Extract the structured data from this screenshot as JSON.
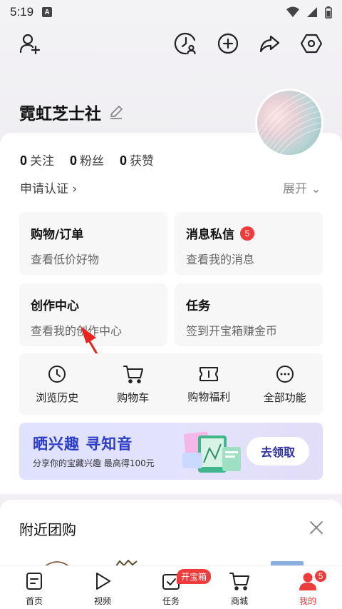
{
  "status_bar": {
    "time": "5:19",
    "a_label": "A"
  },
  "profile": {
    "name": "霓虹芝士社"
  },
  "stats": [
    {
      "num": "0",
      "label": "关注"
    },
    {
      "num": "0",
      "label": "粉丝"
    },
    {
      "num": "0",
      "label": "获赞"
    }
  ],
  "verify_label": "申请认证 ›",
  "expand_label": "展开 ⌄",
  "tiles": {
    "shopping": {
      "title": "购物/订单",
      "sub": "查看低价好物"
    },
    "messages": {
      "title": "消息私信",
      "badge": "5",
      "sub": "查看我的消息"
    },
    "creator": {
      "title": "创作中心",
      "sub": "查看我的创作中心"
    },
    "tasks": {
      "title": "任务",
      "sub": "签到开宝箱赚金币"
    }
  },
  "quick_items": [
    {
      "label": "浏览历史",
      "icon": "clock-icon"
    },
    {
      "label": "购物车",
      "icon": "cart-icon"
    },
    {
      "label": "购物福利",
      "icon": "ticket-icon"
    },
    {
      "label": "全部功能",
      "icon": "more-icon"
    }
  ],
  "banner": {
    "title": "晒兴趣 寻知音",
    "subtitle": "分享你的宝藏兴趣 最高得100元",
    "button": "去领取"
  },
  "nearby": {
    "title": "附近团购"
  },
  "bottom_nav": {
    "items": [
      {
        "label": "首页",
        "icon": "home-icon"
      },
      {
        "label": "视频",
        "icon": "play-icon"
      },
      {
        "label": "任务",
        "icon": "task-icon"
      },
      {
        "label": "商城",
        "icon": "cart-icon"
      },
      {
        "label": "我的",
        "icon": "user-icon"
      }
    ],
    "task_badge": "开宝箱",
    "me_badge": "5"
  },
  "colors": {
    "accent": "#ee3b3b",
    "banner_blue": "#2b3cc7"
  }
}
